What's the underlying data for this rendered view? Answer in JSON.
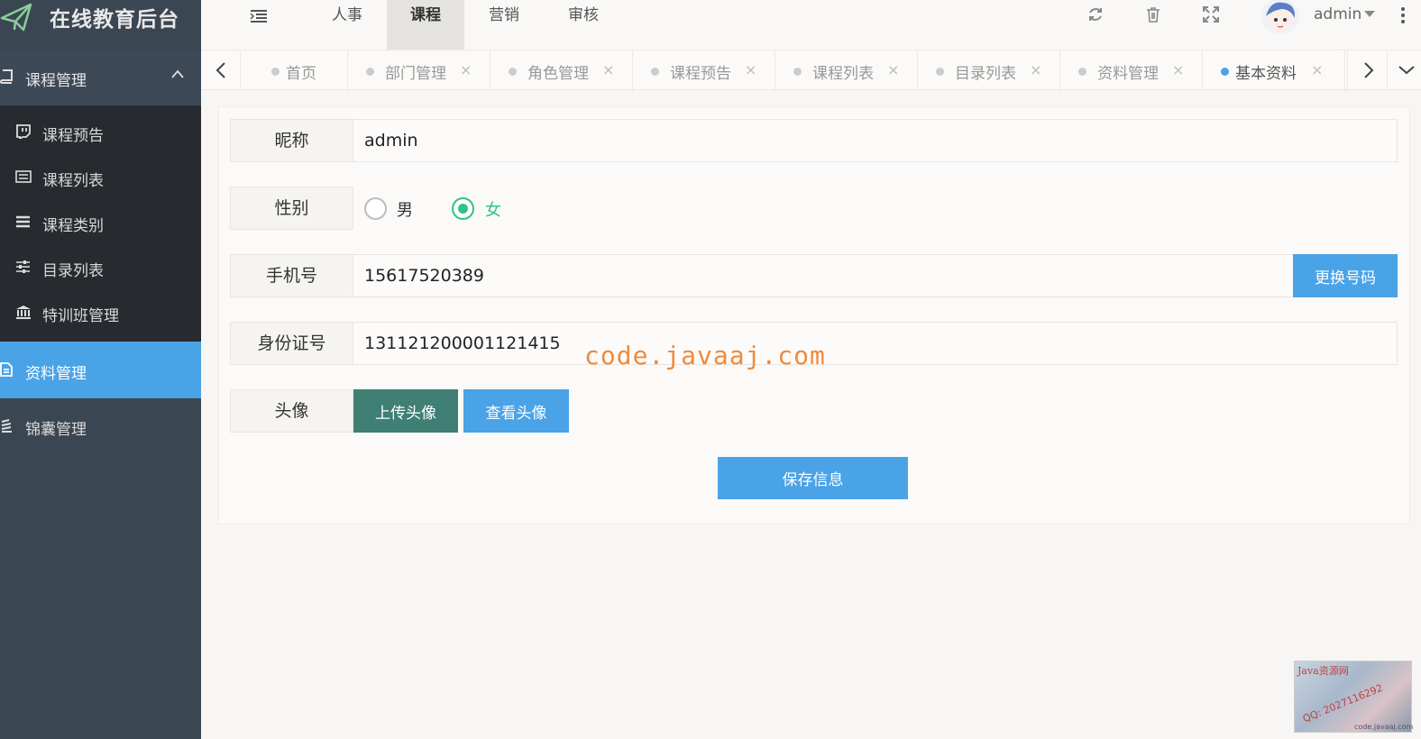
{
  "app": {
    "title": "在线教育后台"
  },
  "sidebar": {
    "group": {
      "label": "课程管理"
    },
    "subitems": [
      {
        "label": "课程预告",
        "icon": "twitch-icon"
      },
      {
        "label": "课程列表",
        "icon": "list-icon"
      },
      {
        "label": "课程类别",
        "icon": "bars-icon"
      },
      {
        "label": "目录列表",
        "icon": "sliders-icon"
      },
      {
        "label": "特训班管理",
        "icon": "bank-icon"
      }
    ],
    "active": {
      "label": "资料管理"
    },
    "extra": {
      "label": "锦囊管理"
    }
  },
  "header": {
    "nav": [
      "人事",
      "课程",
      "营销",
      "审核"
    ],
    "active_nav": "课程",
    "user": "admin"
  },
  "tabs": [
    {
      "label": "首页",
      "closable": false
    },
    {
      "label": "部门管理",
      "closable": true
    },
    {
      "label": "角色管理",
      "closable": true
    },
    {
      "label": "课程预告",
      "closable": true
    },
    {
      "label": "课程列表",
      "closable": true
    },
    {
      "label": "目录列表",
      "closable": true
    },
    {
      "label": "资料管理",
      "closable": true
    },
    {
      "label": "基本资料",
      "closable": true,
      "active": true
    }
  ],
  "form": {
    "nickname": {
      "label": "昵称",
      "value": "admin"
    },
    "gender": {
      "label": "性别",
      "options": [
        "男",
        "女"
      ],
      "selected": "女"
    },
    "phone": {
      "label": "手机号",
      "value": "15617520389",
      "button": "更换号码"
    },
    "idcard": {
      "label": "身份证号",
      "value": "131121200001121415"
    },
    "avatar": {
      "label": "头像",
      "upload": "上传头像",
      "view": "查看头像"
    },
    "save": "保存信息"
  },
  "watermark": "code.javaaj.com",
  "corner": {
    "line1": "Java资源网",
    "line2": "QQ: 2027116292",
    "line3": "code.javaaj.com"
  },
  "colors": {
    "accent": "#4aa3e6",
    "sidebar": "#3b4653",
    "submenu": "#272b2f",
    "success": "#2fc28c",
    "teal": "#3f7f74"
  }
}
